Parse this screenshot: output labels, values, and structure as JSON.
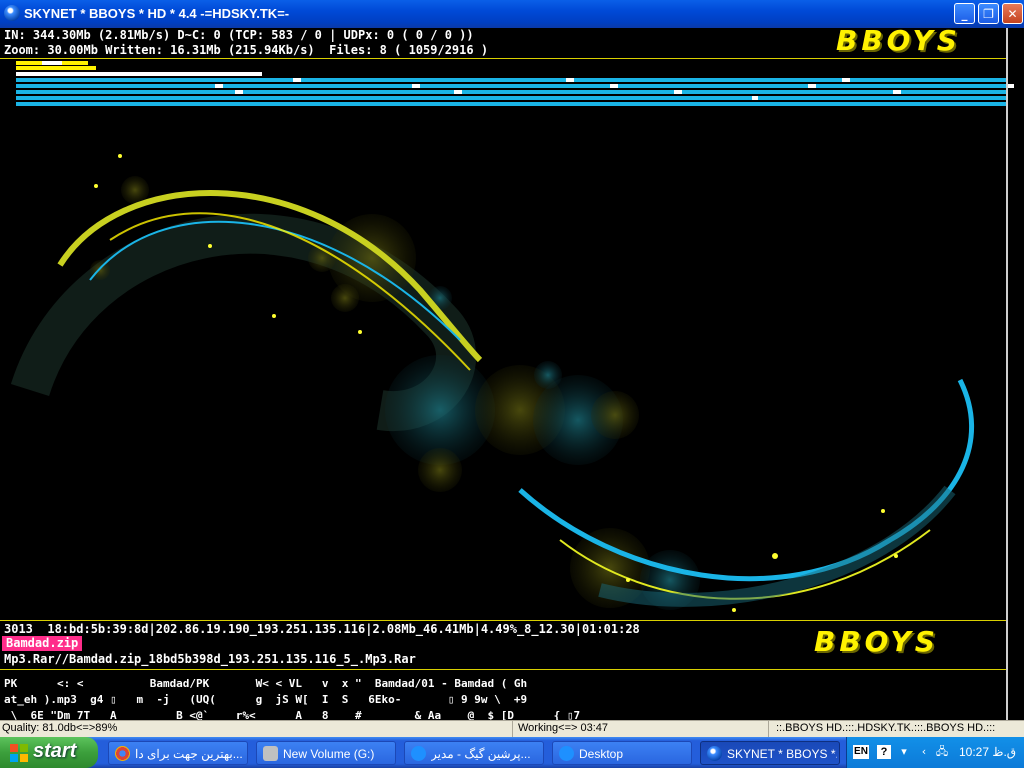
{
  "window": {
    "title": "SKYNET * BBOYS * HD * 4.4 -=HDSKY.TK=-",
    "min_icon": "minimize-icon",
    "max_icon": "restore-icon",
    "close_icon": "close-icon"
  },
  "stats": {
    "line1": "IN: 344.30Mb (2.81Mb/s) D~C: 0 (TCP: 583 / 0 | UDPx: 0 ( 0 / 0 ))",
    "line2": "Zoom: 30.00Mb Written: 16.31Mb (215.94Kb/s)  Files: 8 ( 1059/2916 )"
  },
  "logo_text": "BBOYS",
  "bottom": {
    "session": "3013  18:bd:5b:39:8d|202.86.19.190_193.251.135.116|2.08Mb_46.41Mb|4.49%_8_12.30|01:01:28",
    "filename": "Bamdad.zip",
    "path": "Mp3.Rar//Bamdad.zip_18bd5b398d_193.251.135.116_5_.Mp3.Rar"
  },
  "raw_lines": [
    "PK      <: <          Bamdad/PK       W< < VL   v  x \"  Bamdad/01 - Bamdad ( Gh",
    "at_eh ).mp3  g4 ▯   m  -j   (UQ(      g  jS W[  I  S   6Eko-       ▯ 9 9w \\  +9",
    " \\  6E \"Dm 7T   A         B <@`    r%<      A   8    #        & Aa    @  $ [D      { ▯7"
  ],
  "statusbar": {
    "quality": "Quality: 81.0db<=>89%",
    "working": "Working<=> 03:47",
    "site": "::.BBOYS HD.:::.HDSKY.TK.:::.BBOYS HD.:::"
  },
  "taskbar": {
    "start": "start",
    "tasks": [
      {
        "label": "بهترین جهت برای دا...",
        "icon": "chrome-icon"
      },
      {
        "label": "New Volume (G:)",
        "icon": "drive-icon"
      },
      {
        "label": "پرشین گیگ - مدیر...",
        "icon": "ie-icon"
      },
      {
        "label": "Desktop",
        "icon": "ie-icon"
      },
      {
        "label": "SKYNET * BBOYS *...",
        "icon": "skynet-icon"
      }
    ],
    "lang": "EN",
    "clock": "10:27 ق.ظ"
  },
  "colors": {
    "accent_yellow": "#d9d000",
    "bar_blue": "#1ab4e6",
    "file_pink": "#ff2d8a",
    "taskbar_blue": "#245edb"
  }
}
